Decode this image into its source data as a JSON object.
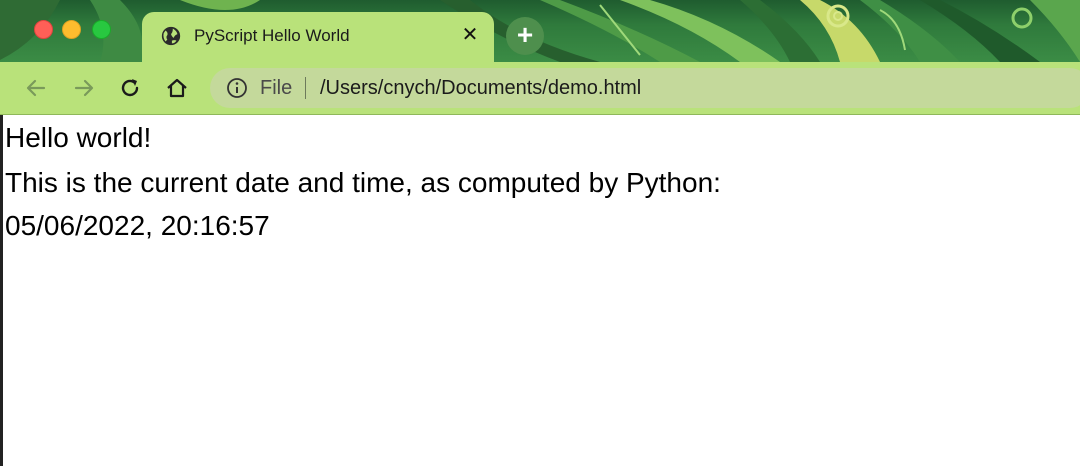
{
  "browser": {
    "tab": {
      "title": "PyScript Hello World",
      "icon": "globe-icon",
      "close_label": "✕"
    },
    "new_tab_label": "+",
    "toolbar": {
      "back_icon": "back-arrow-icon",
      "forward_icon": "forward-arrow-icon",
      "reload_icon": "reload-icon",
      "home_icon": "home-icon"
    },
    "address_bar": {
      "info_icon": "info-icon",
      "scheme_label": "File",
      "url": "/Users/cnych/Documents/demo.html"
    }
  },
  "page": {
    "lines": [
      "Hello world!",
      "This is the current date and time, as computed by Python:",
      "05/06/2022, 20:16:57"
    ]
  },
  "colors": {
    "tab_bg": "#b9e27a",
    "toolbar_bg": "#b9e27a",
    "omnibox_bg": "#c4d99b",
    "new_tab_bg": "#4e8f4d",
    "close_red": "#ff5f57",
    "minimize_yellow": "#febc2e",
    "zoom_green": "#28c840"
  }
}
